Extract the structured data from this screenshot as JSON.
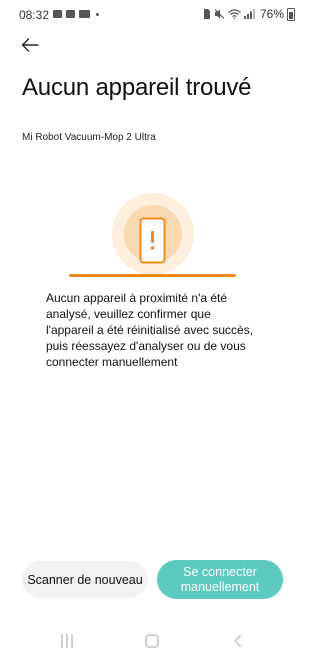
{
  "status_bar": {
    "time": "08:32",
    "battery": "76%",
    "left_icons": [
      "gallery-icon",
      "image-icon",
      "news-icon",
      "notification-dot-icon"
    ],
    "right_icons": [
      "sim-icon",
      "mute-icon",
      "wifi-icon",
      "signal-icon",
      "battery-icon"
    ]
  },
  "header": {
    "back_icon": "arrow-left-icon",
    "title": "Aucun appareil trouvé"
  },
  "device": {
    "name": "Mi Robot Vacuum-Mop 2 Ultra"
  },
  "illustration": {
    "icon": "phone-alert-icon",
    "accent": "#f08a1c",
    "glow_outer": "#fdeedd",
    "glow_inner": "#fbd9b0"
  },
  "message": "Aucun appareil à proximité n'a été analysé, veuillez confirmer que l'appareil a été réinitialisé avec succès, puis réessayez d'analyser ou de vous connecter manuellement",
  "actions": {
    "rescan_label": "Scanner de nouveau",
    "manual_label": "Se connecter manuellement",
    "manual_color": "#5ccabe"
  },
  "nav_bar": {
    "icons": [
      "recents-icon",
      "home-icon",
      "back-icon"
    ]
  }
}
